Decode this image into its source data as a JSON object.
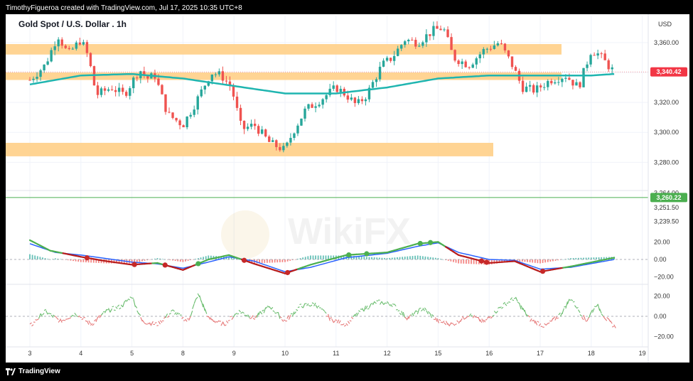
{
  "header": {
    "caption": "TimothyFigueroa created with TradingView.com, Jul 17, 2025 10:35 UTC+8"
  },
  "footer": {
    "brand": "TradingView"
  },
  "watermark": {
    "text": "WikiFX"
  },
  "colors": {
    "bull": "#26a69a",
    "bear": "#ef5350",
    "ma": "#1fb5b0",
    "zone": "#ffcc80",
    "support_line": "#4caf50",
    "price_tag": "#f23645",
    "ind_tag": "#4caf50"
  },
  "chart_data": [
    {
      "type": "candlestick",
      "title": "Gold Spot / U.S. Dollar . 1h",
      "currency": "USD",
      "x_ticks": [
        "3",
        "4",
        "5",
        "8",
        "9",
        "10",
        "11",
        "12",
        "15",
        "16",
        "17",
        "18",
        "19"
      ],
      "ylim": [
        3264,
        3378
      ],
      "y_ticks": [
        3280,
        3300,
        3320,
        3340,
        3360
      ],
      "y_tick_labels": [
        "3,280.00",
        "3,300.00",
        "3,320.00",
        "3,340.00",
        "3,360.00"
      ],
      "last_price": 3340.42,
      "last_price_label": "3,340.42",
      "zones": [
        {
          "from_day": "3",
          "to_day": "17",
          "low": 3352,
          "high": 3359
        },
        {
          "from_day": "3",
          "to_day": "17",
          "low": 3335,
          "high": 3340
        },
        {
          "from_day": "3",
          "to_day": "16",
          "low": 3284,
          "high": 3293
        }
      ],
      "anchors": [
        {
          "d": 0,
          "p": 3335
        },
        {
          "d": 0.3,
          "p": 3345
        },
        {
          "d": 0.55,
          "p": 3365
        },
        {
          "d": 0.75,
          "p": 3352
        },
        {
          "d": 1.0,
          "p": 3362
        },
        {
          "d": 1.15,
          "p": 3350
        },
        {
          "d": 1.3,
          "p": 3325
        },
        {
          "d": 1.6,
          "p": 3330
        },
        {
          "d": 1.85,
          "p": 3325
        },
        {
          "d": 2.15,
          "p": 3342
        },
        {
          "d": 2.3,
          "p": 3336
        },
        {
          "d": 2.45,
          "p": 3338
        },
        {
          "d": 2.7,
          "p": 3312
        },
        {
          "d": 3.0,
          "p": 3305
        },
        {
          "d": 3.25,
          "p": 3320
        },
        {
          "d": 3.55,
          "p": 3340
        },
        {
          "d": 3.75,
          "p": 3338
        },
        {
          "d": 3.95,
          "p": 3330
        },
        {
          "d": 4.15,
          "p": 3302
        },
        {
          "d": 4.4,
          "p": 3305
        },
        {
          "d": 4.7,
          "p": 3293
        },
        {
          "d": 5.0,
          "p": 3288
        },
        {
          "d": 5.15,
          "p": 3300
        },
        {
          "d": 5.4,
          "p": 3315
        },
        {
          "d": 5.7,
          "p": 3322
        },
        {
          "d": 6.0,
          "p": 3330
        },
        {
          "d": 6.2,
          "p": 3325
        },
        {
          "d": 6.4,
          "p": 3318
        },
        {
          "d": 6.6,
          "p": 3325
        },
        {
          "d": 6.9,
          "p": 3345
        },
        {
          "d": 7.1,
          "p": 3350
        },
        {
          "d": 7.35,
          "p": 3362
        },
        {
          "d": 7.6,
          "p": 3360
        },
        {
          "d": 7.9,
          "p": 3368
        },
        {
          "d": 8.1,
          "p": 3370
        },
        {
          "d": 8.3,
          "p": 3350
        },
        {
          "d": 8.6,
          "p": 3345
        },
        {
          "d": 8.9,
          "p": 3355
        },
        {
          "d": 9.2,
          "p": 3360
        },
        {
          "d": 9.45,
          "p": 3345
        },
        {
          "d": 9.65,
          "p": 3330
        },
        {
          "d": 9.9,
          "p": 3328
        },
        {
          "d": 10.2,
          "p": 3335
        },
        {
          "d": 10.5,
          "p": 3338
        },
        {
          "d": 10.75,
          "p": 3330
        },
        {
          "d": 11.0,
          "p": 3355
        },
        {
          "d": 11.15,
          "p": 3352
        },
        {
          "d": 11.35,
          "p": 3344
        },
        {
          "d": 11.45,
          "p": 3340.42
        }
      ],
      "ma_anchors": [
        {
          "d": 0,
          "p": 3332
        },
        {
          "d": 1.0,
          "p": 3338
        },
        {
          "d": 2.0,
          "p": 3339
        },
        {
          "d": 3.0,
          "p": 3336
        },
        {
          "d": 4.0,
          "p": 3331
        },
        {
          "d": 5.0,
          "p": 3326
        },
        {
          "d": 6.0,
          "p": 3326
        },
        {
          "d": 7.0,
          "p": 3330
        },
        {
          "d": 8.0,
          "p": 3336
        },
        {
          "d": 9.0,
          "p": 3338
        },
        {
          "d": 10.0,
          "p": 3338
        },
        {
          "d": 11.0,
          "p": 3338
        },
        {
          "d": 11.45,
          "p": 3339
        }
      ]
    },
    {
      "type": "price_scale",
      "ylim": [
        3228,
        3270
      ],
      "y_tick_labels": [
        "3,264.00",
        "3,251.50",
        "3,239.50"
      ],
      "y_ticks": [
        3264,
        3251.5,
        3239.5
      ],
      "marker_value": 3260.22,
      "marker_label": "3,260.22"
    },
    {
      "type": "line",
      "name": "momentum-oscillator",
      "ylim": [
        -30,
        30
      ],
      "y_ticks": [
        20,
        0,
        -20
      ],
      "y_tick_labels": [
        "20.00",
        "0.00",
        "−20.00"
      ],
      "fast_anchors": [
        {
          "d": 0,
          "p": 22
        },
        {
          "d": 0.4,
          "p": 10
        },
        {
          "d": 1.0,
          "p": 3
        },
        {
          "d": 1.5,
          "p": -2
        },
        {
          "d": 2.0,
          "p": -6
        },
        {
          "d": 2.5,
          "p": -4
        },
        {
          "d": 3.0,
          "p": -12
        },
        {
          "d": 3.5,
          "p": 0
        },
        {
          "d": 3.9,
          "p": 5
        },
        {
          "d": 4.4,
          "p": -5
        },
        {
          "d": 5.0,
          "p": -16
        },
        {
          "d": 5.5,
          "p": -6
        },
        {
          "d": 6.2,
          "p": 5
        },
        {
          "d": 7.0,
          "p": 8
        },
        {
          "d": 7.6,
          "p": 18
        },
        {
          "d": 8.0,
          "p": 20
        },
        {
          "d": 8.4,
          "p": 5
        },
        {
          "d": 9.0,
          "p": -4
        },
        {
          "d": 9.5,
          "p": -2
        },
        {
          "d": 10.0,
          "p": -14
        },
        {
          "d": 10.6,
          "p": -8
        },
        {
          "d": 11.45,
          "p": 2
        }
      ],
      "slow_anchors": [
        {
          "d": 0,
          "p": 18
        },
        {
          "d": 0.5,
          "p": 8
        },
        {
          "d": 1.0,
          "p": 5
        },
        {
          "d": 1.5,
          "p": 1
        },
        {
          "d": 2.0,
          "p": -3
        },
        {
          "d": 2.5,
          "p": -5
        },
        {
          "d": 3.0,
          "p": -10
        },
        {
          "d": 3.5,
          "p": -3
        },
        {
          "d": 3.9,
          "p": 3
        },
        {
          "d": 4.4,
          "p": -2
        },
        {
          "d": 5.0,
          "p": -14
        },
        {
          "d": 5.5,
          "p": -9
        },
        {
          "d": 6.2,
          "p": 2
        },
        {
          "d": 7.0,
          "p": 7
        },
        {
          "d": 7.6,
          "p": 15
        },
        {
          "d": 8.0,
          "p": 19
        },
        {
          "d": 8.4,
          "p": 8
        },
        {
          "d": 9.0,
          "p": 0
        },
        {
          "d": 9.5,
          "p": -1
        },
        {
          "d": 10.0,
          "p": -11
        },
        {
          "d": 10.6,
          "p": -9
        },
        {
          "d": 11.45,
          "p": 0
        }
      ],
      "cross_days": [
        1.12,
        2.05,
        2.65,
        3.3,
        4.2,
        5.05,
        6.25,
        6.6,
        7.65,
        7.85,
        8.85,
        8.95,
        10.05
      ]
    },
    {
      "type": "line",
      "name": "rsi-oscillator",
      "ylim": [
        -30,
        30
      ],
      "y_ticks": [
        20,
        0,
        -20
      ],
      "y_tick_labels": [
        "20.00",
        "0.00",
        "−20.00"
      ],
      "anchors": [
        {
          "d": 0,
          "p": -10
        },
        {
          "d": 0.3,
          "p": 5
        },
        {
          "d": 0.6,
          "p": -5
        },
        {
          "d": 0.9,
          "p": 3
        },
        {
          "d": 1.2,
          "p": -8
        },
        {
          "d": 1.5,
          "p": 5
        },
        {
          "d": 1.8,
          "p": 10
        },
        {
          "d": 2.0,
          "p": 20
        },
        {
          "d": 2.2,
          "p": -5
        },
        {
          "d": 2.5,
          "p": -8
        },
        {
          "d": 2.8,
          "p": 5
        },
        {
          "d": 3.1,
          "p": -5
        },
        {
          "d": 3.3,
          "p": 22
        },
        {
          "d": 3.5,
          "p": -2
        },
        {
          "d": 3.8,
          "p": -8
        },
        {
          "d": 4.1,
          "p": 5
        },
        {
          "d": 4.4,
          "p": -2
        },
        {
          "d": 4.7,
          "p": 10
        },
        {
          "d": 5.0,
          "p": -5
        },
        {
          "d": 5.3,
          "p": 10
        },
        {
          "d": 5.6,
          "p": 12
        },
        {
          "d": 5.9,
          "p": -3
        },
        {
          "d": 6.2,
          "p": -8
        },
        {
          "d": 6.5,
          "p": 6
        },
        {
          "d": 6.8,
          "p": 14
        },
        {
          "d": 7.1,
          "p": 12
        },
        {
          "d": 7.4,
          "p": -2
        },
        {
          "d": 7.7,
          "p": 8
        },
        {
          "d": 8.0,
          "p": -5
        },
        {
          "d": 8.3,
          "p": -8
        },
        {
          "d": 8.6,
          "p": 2
        },
        {
          "d": 8.9,
          "p": -6
        },
        {
          "d": 9.2,
          "p": 8
        },
        {
          "d": 9.5,
          "p": 18
        },
        {
          "d": 9.8,
          "p": -3
        },
        {
          "d": 10.1,
          "p": -10
        },
        {
          "d": 10.4,
          "p": 2
        },
        {
          "d": 10.6,
          "p": 18
        },
        {
          "d": 10.9,
          "p": -5
        },
        {
          "d": 11.1,
          "p": 12
        },
        {
          "d": 11.3,
          "p": -3
        },
        {
          "d": 11.45,
          "p": -10
        }
      ]
    }
  ]
}
